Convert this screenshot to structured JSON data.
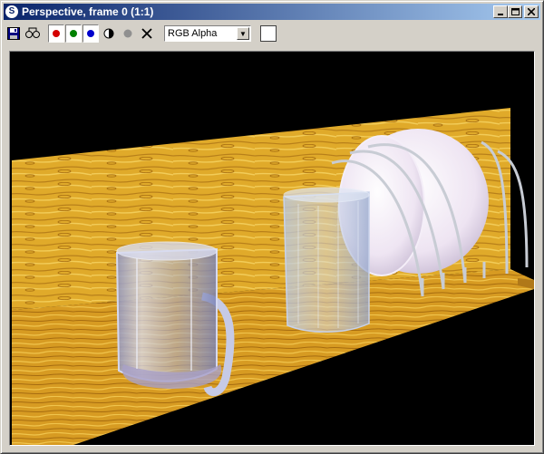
{
  "window": {
    "title": "Perspective, frame 0 (1:1)",
    "icon": "3dsmax-app-icon"
  },
  "titlebar_buttons": [
    {
      "name": "minimize",
      "glyph": "_"
    },
    {
      "name": "maximize",
      "glyph": "□"
    },
    {
      "name": "close",
      "glyph": "✕"
    }
  ],
  "toolbar": {
    "save_icon": "floppy-save-icon",
    "clone_icon": "clone-window-icon",
    "channels": [
      {
        "name": "red",
        "color": "#d40000"
      },
      {
        "name": "green",
        "color": "#008000"
      },
      {
        "name": "blue",
        "color": "#0000cc"
      }
    ],
    "alpha_icon": "half-circle-alpha-icon",
    "mono_icon": "monochrome-dot-icon",
    "clear_icon": "x-clear-icon",
    "channel_select": {
      "value": "RGB Alpha"
    },
    "color_swatch": "#ffffff"
  },
  "viewport": {
    "background": "#000000",
    "scene": [
      "wood-panel-background",
      "wood-shelf",
      "glass-mug",
      "glass-tumbler",
      "dish-rack-with-plates"
    ]
  }
}
